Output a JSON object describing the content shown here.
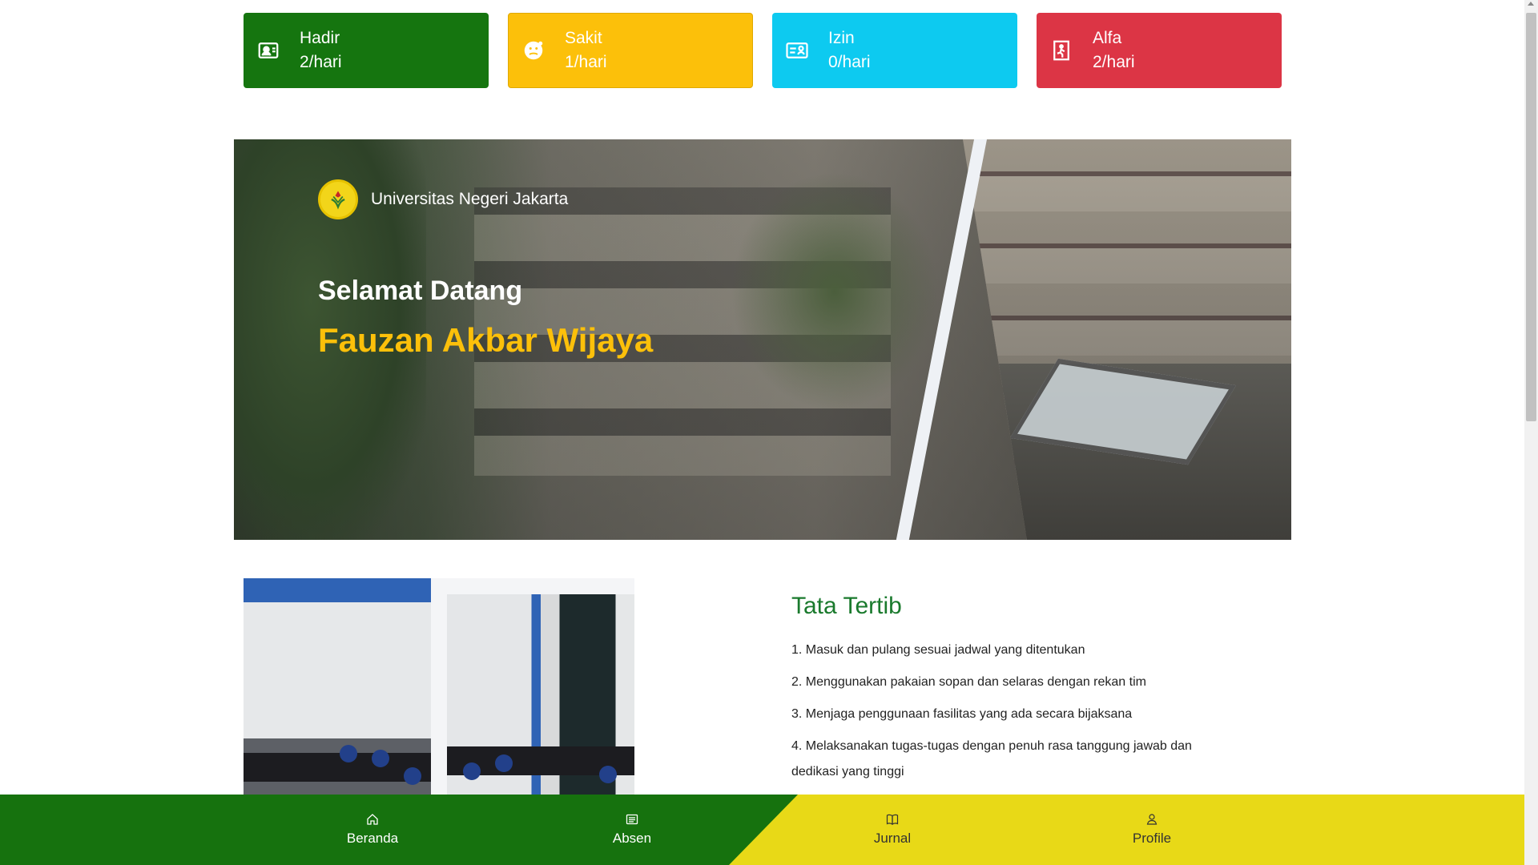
{
  "stats": [
    {
      "label": "Hadir",
      "value": "2/hari",
      "icon": "person-badge-icon",
      "color": "#15750f"
    },
    {
      "label": "Sakit",
      "value": "1/hari",
      "icon": "sick-face-icon",
      "color": "#fcc00a"
    },
    {
      "label": "Izin",
      "value": "0/hari",
      "icon": "id-card-icon",
      "color": "#0dcaf0"
    },
    {
      "label": "Alfa",
      "value": "2/hari",
      "icon": "exit-door-icon",
      "color": "#dc3545"
    }
  ],
  "hero": {
    "university": "Universitas Negeri Jakarta",
    "welcome": "Selamat Datang",
    "name": "Fauzan Akbar Wijaya",
    "name_color": "#fcc00a"
  },
  "rules": {
    "title": "Tata Tertib",
    "items": [
      "1. Masuk dan pulang sesuai jadwal yang ditentukan",
      "2. Menggunakan pakaian sopan dan selaras dengan rekan tim",
      "3. Menjaga penggunaan fasilitas yang ada secara bijaksana",
      "4. Melaksanakan tugas-tugas dengan penuh rasa tanggung jawab dan dedikasi yang tinggi"
    ]
  },
  "nav": [
    {
      "label": "Beranda",
      "icon": "home-icon"
    },
    {
      "label": "Absen",
      "icon": "list-card-icon"
    },
    {
      "label": "Jurnal",
      "icon": "book-open-icon"
    },
    {
      "label": "Profile",
      "icon": "person-icon"
    }
  ],
  "colors": {
    "nav_green": "#16720e",
    "nav_yellow": "#e8d917",
    "rules_title": "#1a7a2d"
  }
}
